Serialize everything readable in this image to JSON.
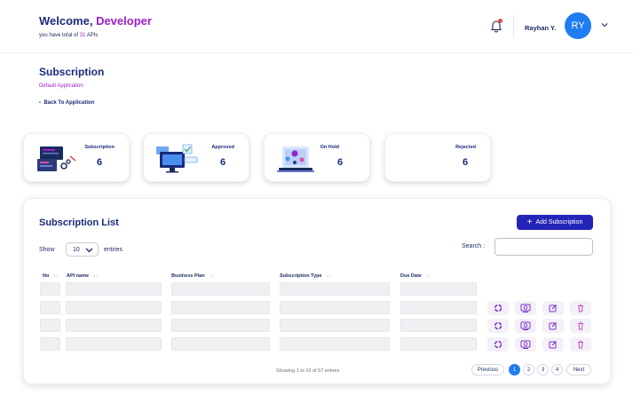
{
  "header": {
    "welcome_prefix": "Welcome, ",
    "welcome_name": "Developer",
    "apis_prefix": "you have total of ",
    "apis_count": "31",
    "apis_suffix": " APIs",
    "username": "Rayhan Y.",
    "avatar_initials": "RY"
  },
  "page": {
    "title": "Subscription",
    "subtitle": "Default Application",
    "back_link": "Back To Application"
  },
  "cards": [
    {
      "label": "Subscription",
      "value": "6"
    },
    {
      "label": "Approved",
      "value": "6"
    },
    {
      "label": "On Hold",
      "value": "6"
    },
    {
      "label": "Rejected",
      "value": "6"
    }
  ],
  "list": {
    "title": "Subscription List",
    "add_button": "Add Subscription",
    "show_label": "Show",
    "show_value": "10",
    "entries_label": "entries",
    "search_label": "Search :",
    "columns": [
      "No",
      "API name",
      "Business Plan",
      "Subscription Type",
      "Due Date"
    ],
    "showing_text": "Showing 1 to 10 of 57 entries",
    "pagination": {
      "previous": "Previous",
      "pages": [
        "1",
        "2",
        "3",
        "4"
      ],
      "next": "Next",
      "current": "1"
    }
  },
  "icons": {
    "bell": "bell-icon",
    "chevron": "chevron-down-icon",
    "refresh": "refresh-icon",
    "view": "monitor-search-icon",
    "edit": "edit-icon",
    "delete": "trash-icon"
  },
  "colors": {
    "primary_navy": "#1a2a7a",
    "accent_purple": "#9b1fc9",
    "button_blue": "#2424b8",
    "avatar_blue": "#1e7df0"
  }
}
